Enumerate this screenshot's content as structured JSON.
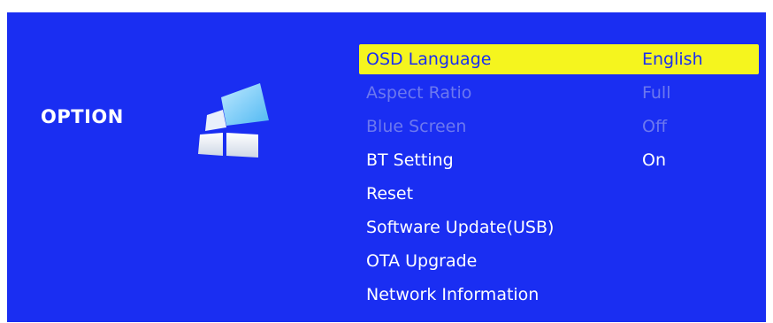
{
  "section": {
    "title": "OPTION",
    "icon": "option-windows-icon"
  },
  "colors": {
    "background": "#1a2ef2",
    "highlight": "#f5f51e",
    "text": "#ffffff",
    "disabled_text": "#8f98ee"
  },
  "menu": {
    "items": [
      {
        "label": "OSD Language",
        "value": "English",
        "state": "selected"
      },
      {
        "label": "Aspect Ratio",
        "value": "Full",
        "state": "disabled"
      },
      {
        "label": "Blue Screen",
        "value": "Off",
        "state": "disabled"
      },
      {
        "label": "BT Setting",
        "value": "On",
        "state": "normal"
      },
      {
        "label": "Reset",
        "value": "",
        "state": "normal"
      },
      {
        "label": "Software Update(USB)",
        "value": "",
        "state": "normal"
      },
      {
        "label": "OTA Upgrade",
        "value": "",
        "state": "normal"
      },
      {
        "label": "Network Information",
        "value": "",
        "state": "normal"
      }
    ]
  }
}
